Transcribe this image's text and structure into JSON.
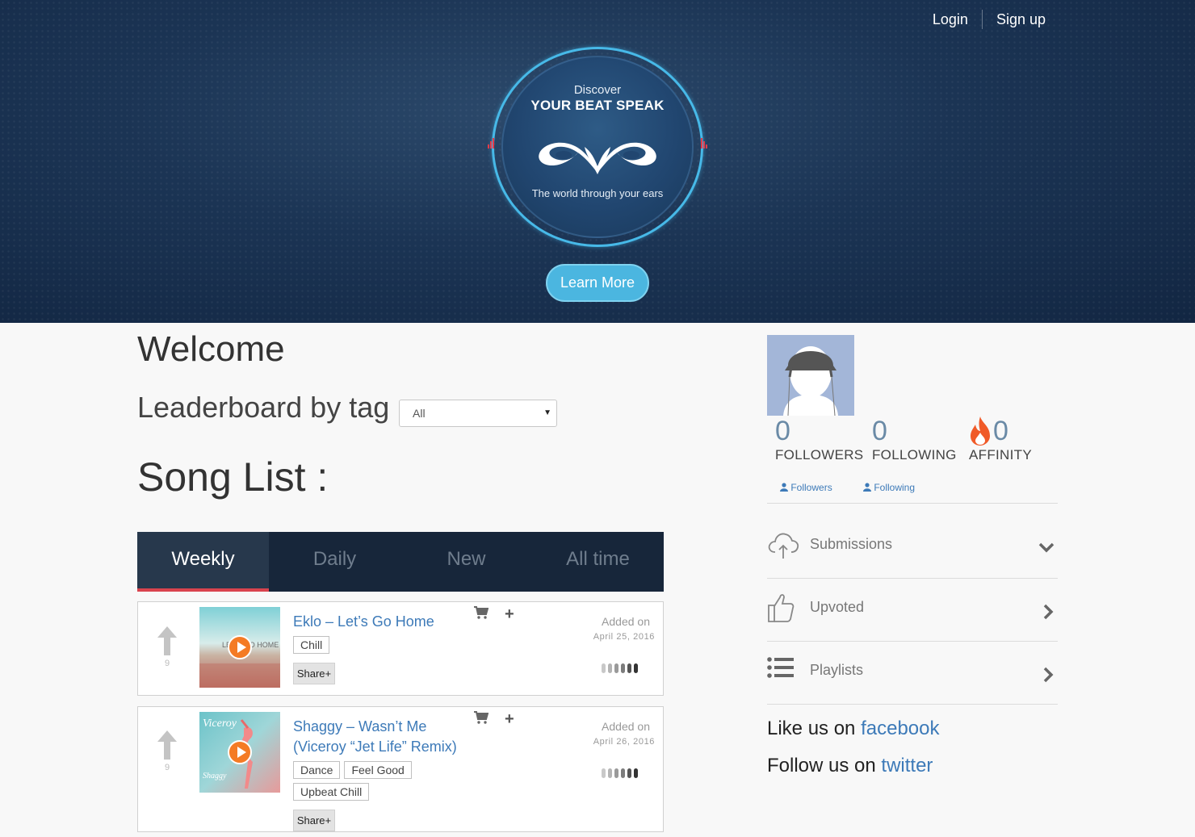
{
  "nav": {
    "login": "Login",
    "signup": "Sign up"
  },
  "hero": {
    "discover": "Discover",
    "brand": "YOUR BEAT SPEAK",
    "tagline": "The world through your ears",
    "learn_more": "Learn More"
  },
  "main": {
    "welcome": "Welcome",
    "leaderboard_label": "Leaderboard by tag :",
    "leaderboard_selected": "All",
    "song_list_label": "Song List :",
    "tabs": [
      "Weekly",
      "Daily",
      "New",
      "All time"
    ],
    "active_tab": "Weekly",
    "songs": [
      {
        "title": "Eklo – Let’s Go Home",
        "votes": "9",
        "tags": [
          "Chill"
        ],
        "share": "Share+",
        "added_label": "Added on",
        "added_date": "April 25, 2016"
      },
      {
        "title_line1": "Shaggy – Wasn’t Me",
        "title_line2": "(Viceroy “Jet Life” Remix)",
        "votes": "9",
        "tags": [
          "Dance",
          "Feel Good",
          "Upbeat Chill"
        ],
        "share": "Share+",
        "added_label": "Added on",
        "added_date": "April 26, 2016"
      }
    ]
  },
  "sidebar": {
    "stats": [
      {
        "value": "0",
        "label": "FOLLOWERS"
      },
      {
        "value": "0",
        "label": "FOLLOWING"
      },
      {
        "value": "0",
        "label": "AFFINITY"
      }
    ],
    "links": {
      "followers": "Followers",
      "following": "Following"
    },
    "items": [
      {
        "label": "Submissions",
        "icon": "cloud-upload-icon",
        "chevron": "down"
      },
      {
        "label": "Upvoted",
        "icon": "thumbs-up-icon",
        "chevron": "right"
      },
      {
        "label": "Playlists",
        "icon": "list-icon",
        "chevron": "right"
      }
    ],
    "facebook_prefix": "Like us on",
    "facebook_link": "facebook",
    "twitter_prefix": "Follow us on",
    "twitter_link": "twitter"
  },
  "colors": {
    "accent": "#4bb6e0",
    "link": "#3d7ab8",
    "tab_bar": "#17263a",
    "tab_active_underline": "#d9434e",
    "play": "#f47b25",
    "affinity_flame": "#f05a28"
  }
}
